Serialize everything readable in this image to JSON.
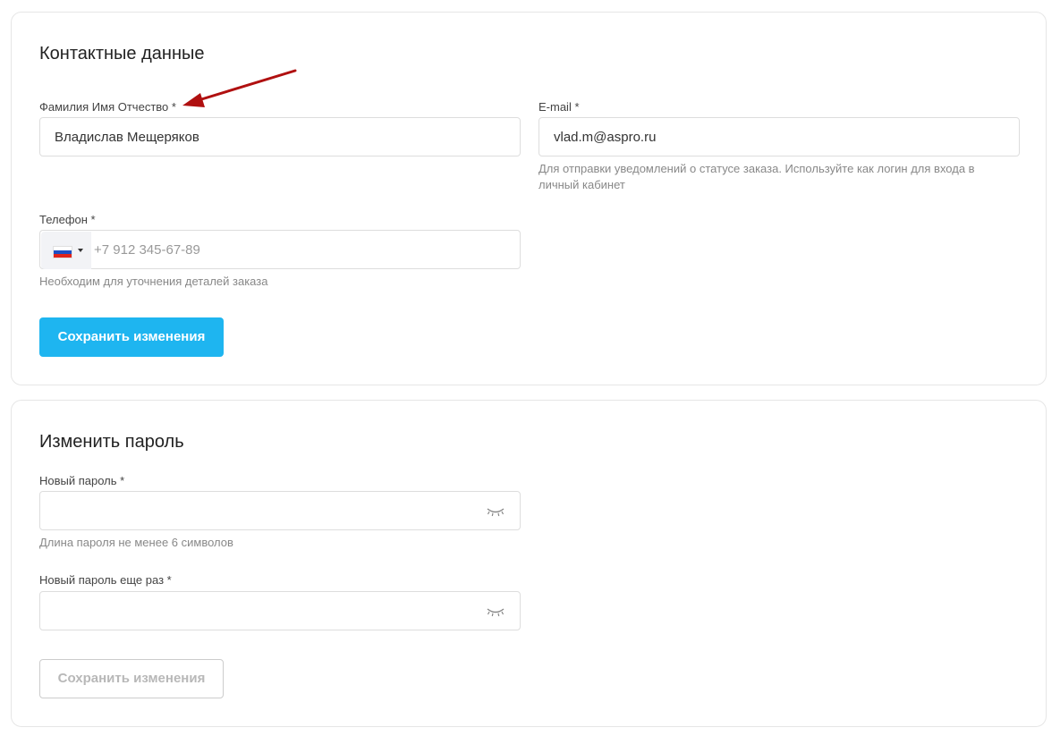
{
  "contacts": {
    "title": "Контактные данные",
    "fio_label": "Фамилия Имя Отчество *",
    "fio_value": "Владислав Мещеряков",
    "email_label": "E-mail *",
    "email_value": "vlad.m@aspro.ru",
    "email_hint_line1": "Для отправки уведомлений о статусе заказа. Используйте как логин для входа в",
    "email_hint_line2": "личный кабинет",
    "phone_label": "Телефон *",
    "phone_placeholder": "+7 912 345-67-89",
    "phone_hint": "Необходим для уточнения деталей заказа",
    "phone_country_flag": "russia-flag",
    "save_label": "Сохранить изменения"
  },
  "password": {
    "title": "Изменить пароль",
    "new_label": "Новый пароль *",
    "new_value": "",
    "new_hint": "Длина пароля не менее 6 символов",
    "repeat_label": "Новый пароль еще раз *",
    "repeat_value": "",
    "save_label": "Сохранить изменения"
  },
  "colors": {
    "accent": "#1eb5f0",
    "annotation_arrow": "#b01010",
    "hint_text": "#888888"
  }
}
